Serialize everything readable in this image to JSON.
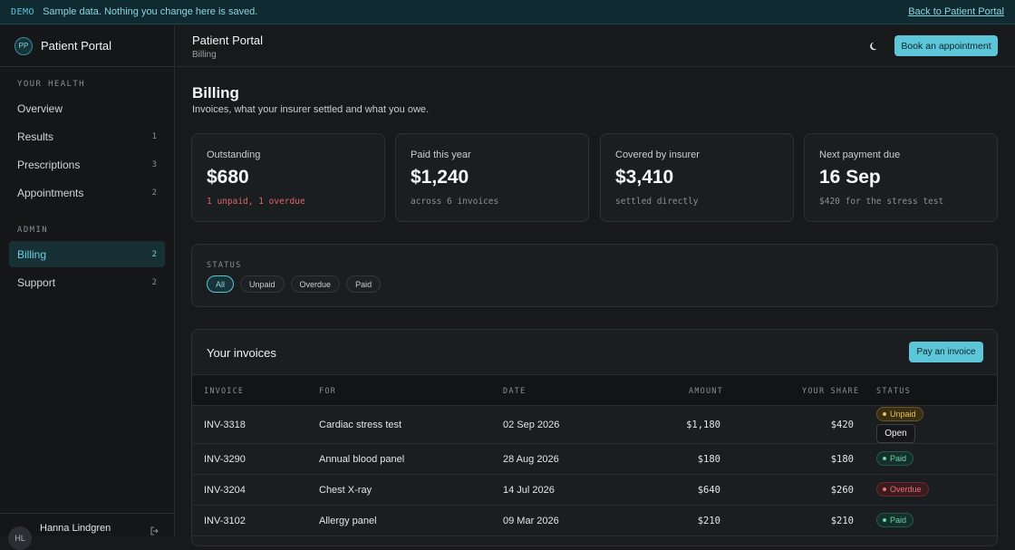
{
  "demo_bar": {
    "tag": "DEMO",
    "message": "Sample data. Nothing you change here is saved.",
    "back_link": "Back to Patient Portal"
  },
  "sidebar": {
    "brand_initials": "PP",
    "brand_name": "Patient Portal",
    "sections": [
      {
        "title": "YOUR HEALTH",
        "items": [
          {
            "label": "Overview",
            "count": ""
          },
          {
            "label": "Results",
            "count": "1"
          },
          {
            "label": "Prescriptions",
            "count": "3"
          },
          {
            "label": "Appointments",
            "count": "2"
          }
        ]
      },
      {
        "title": "ADMIN",
        "items": [
          {
            "label": "Billing",
            "count": "2"
          },
          {
            "label": "Support",
            "count": "2"
          }
        ]
      }
    ],
    "active_item": "Billing",
    "user": {
      "initials": "HL",
      "name": "Hanna Lindgren",
      "action_icon": "sign-out-icon"
    }
  },
  "header": {
    "title": "Patient Portal",
    "breadcrumb": "Billing",
    "theme_icon": "moon-icon",
    "book_button": "Book an appointment"
  },
  "page": {
    "title": "Billing",
    "subtitle": "Invoices, what your insurer settled and what you owe."
  },
  "stats": [
    {
      "label": "Outstanding",
      "value": "$680",
      "note": "1 unpaid, 1 overdue",
      "alert": true
    },
    {
      "label": "Paid this year",
      "value": "$1,240",
      "note": "across 6 invoices",
      "alert": false
    },
    {
      "label": "Covered by insurer",
      "value": "$3,410",
      "note": "settled directly",
      "alert": false
    },
    {
      "label": "Next payment due",
      "value": "16 Sep",
      "note": "$420 for the stress test",
      "alert": false
    }
  ],
  "filter": {
    "label": "STATUS",
    "options": [
      "All",
      "Unpaid",
      "Overdue",
      "Paid"
    ],
    "selected": "All"
  },
  "invoices": {
    "title": "Your invoices",
    "pay_button": "Pay an invoice",
    "columns": [
      "INVOICE",
      "FOR",
      "DATE",
      "AMOUNT",
      "YOUR SHARE",
      "STATUS"
    ],
    "rows": [
      {
        "invoice": "INV-3318",
        "for": "Cardiac stress test",
        "date": "02 Sep 2026",
        "amount": "$1,180",
        "share": "$420",
        "status": "Unpaid",
        "status_kind": "unpaid",
        "action": "Open"
      },
      {
        "invoice": "INV-3290",
        "for": "Annual blood panel",
        "date": "28 Aug 2026",
        "amount": "$180",
        "share": "$180",
        "status": "Paid",
        "status_kind": "paid",
        "action": ""
      },
      {
        "invoice": "INV-3204",
        "for": "Chest X-ray",
        "date": "14 Jul 2026",
        "amount": "$640",
        "share": "$260",
        "status": "Overdue",
        "status_kind": "overdue",
        "action": ""
      },
      {
        "invoice": "INV-3102",
        "for": "Allergy panel",
        "date": "09 Mar 2026",
        "amount": "$210",
        "share": "$210",
        "status": "Paid",
        "status_kind": "paid",
        "action": ""
      }
    ]
  },
  "colors": {
    "accent": "#5cc6d8",
    "background": "#17191b",
    "alert": "#e0636b",
    "unpaid": "#e8c05a",
    "paid": "#6ad3a6",
    "overdue": "#e7707a"
  }
}
